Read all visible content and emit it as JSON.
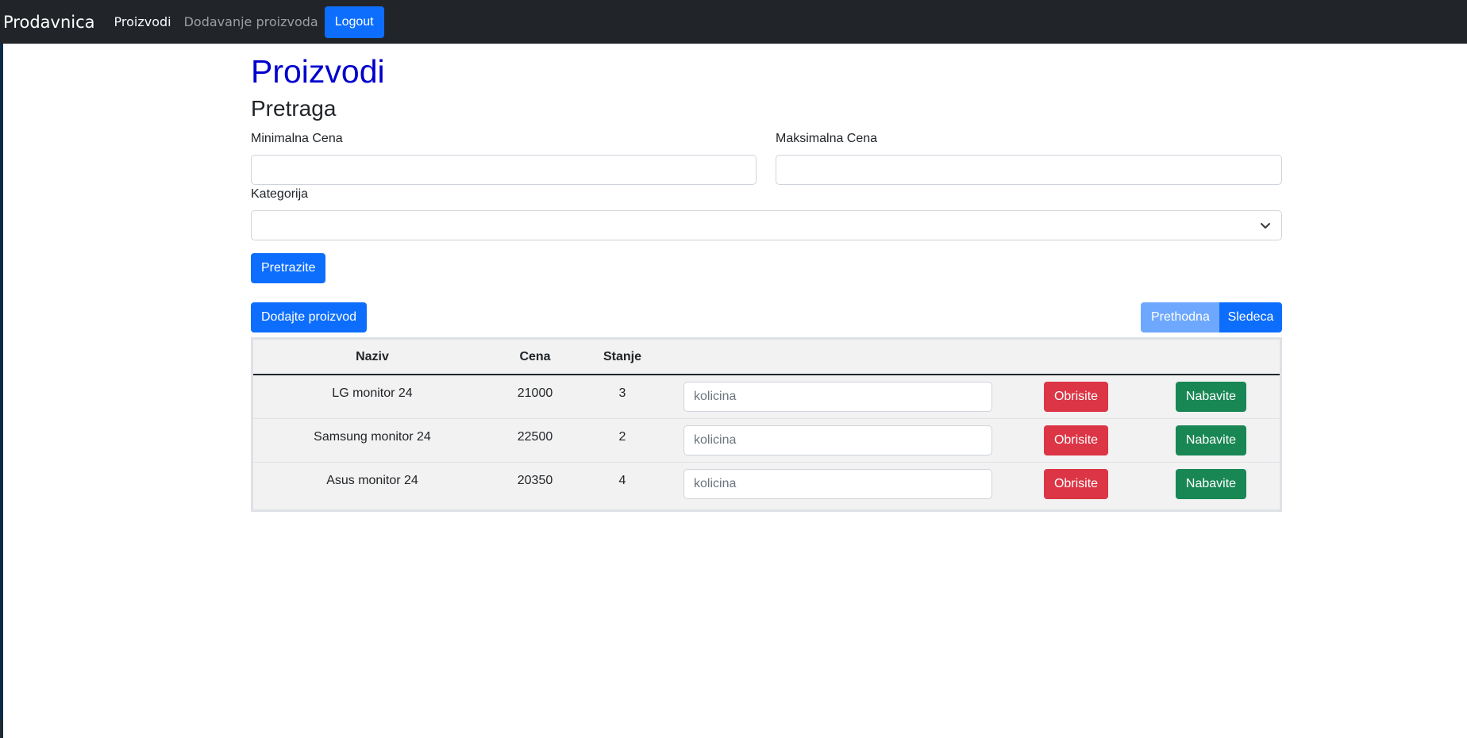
{
  "navbar": {
    "brand": "Prodavnica",
    "links": [
      "Proizvodi",
      "Dodavanje proizvoda"
    ],
    "logout_label": "Logout"
  },
  "page": {
    "title": "Proizvodi",
    "search_heading": "Pretraga"
  },
  "search": {
    "min_price_label": "Minimalna Cena",
    "min_price_value": "",
    "max_price_label": "Maksimalna Cena",
    "max_price_value": "",
    "category_label": "Kategorija",
    "category_selected": "",
    "submit_label": "Pretrazite"
  },
  "actions": {
    "add_product_label": "Dodajte proizvod",
    "prev_label": "Prethodna",
    "next_label": "Sledeca"
  },
  "table": {
    "headers": [
      "Naziv",
      "Cena",
      "Stanje"
    ],
    "quantity_placeholder": "kolicina",
    "delete_label": "Obrisite",
    "order_label": "Nabavite",
    "rows": [
      {
        "naziv": "LG monitor 24",
        "cena": "21000",
        "stanje": "3"
      },
      {
        "naziv": "Samsung monitor 24",
        "cena": "22500",
        "stanje": "2"
      },
      {
        "naziv": "Asus monitor 24",
        "cena": "20350",
        "stanje": "4"
      }
    ]
  },
  "colors": {
    "navbar_bg": "#212529",
    "primary": "#0d6efd",
    "danger": "#dc3545",
    "success": "#198754",
    "title": "#0000cd"
  }
}
